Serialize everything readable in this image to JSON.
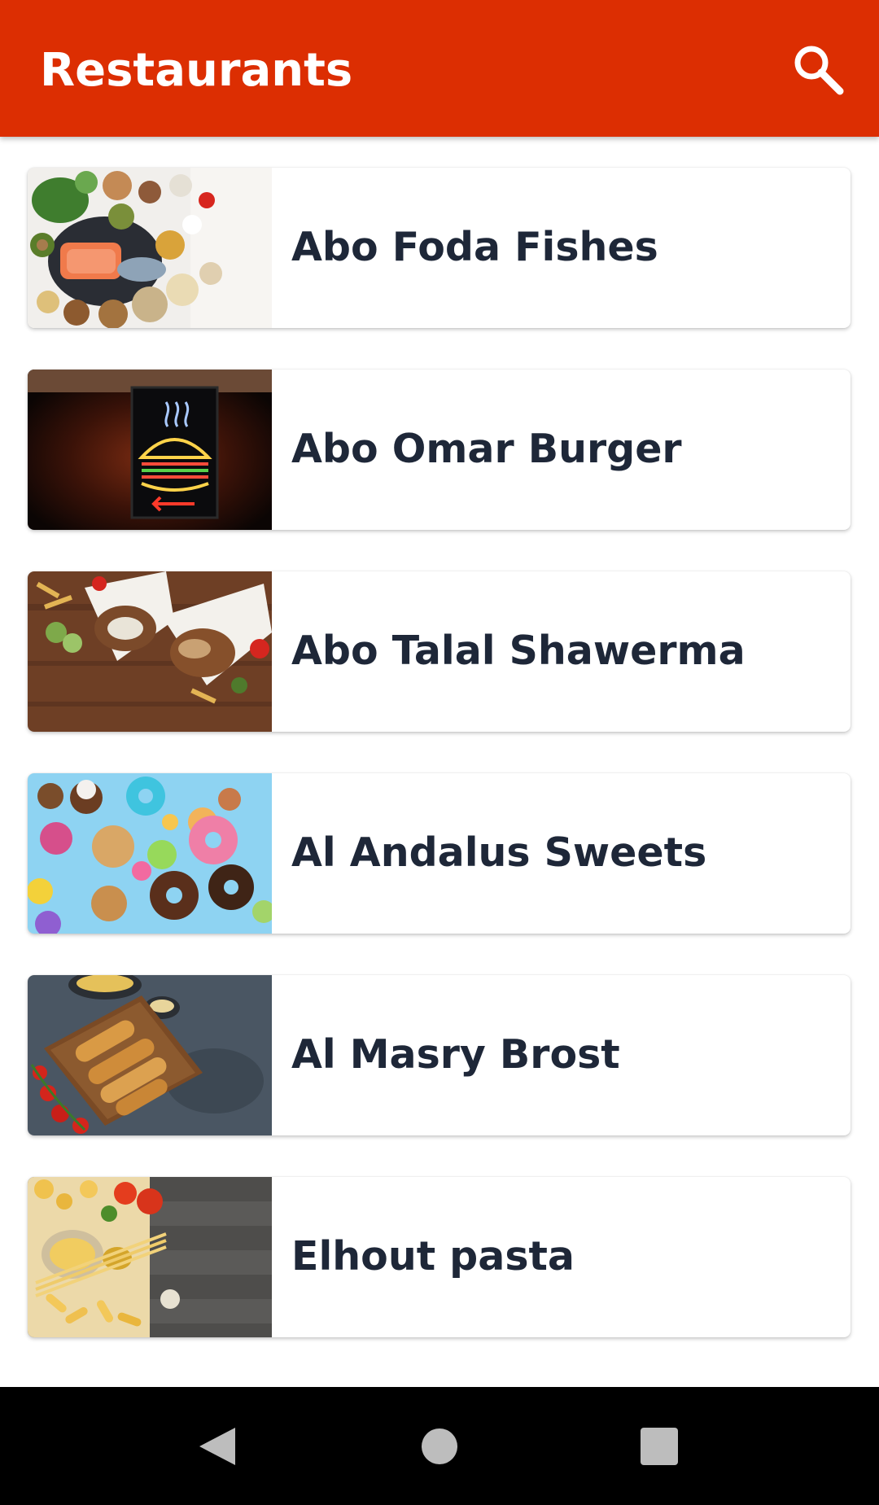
{
  "app_bar": {
    "title": "Restaurants",
    "background_color": "#dc2e02",
    "search_icon": "search-icon"
  },
  "restaurants": [
    {
      "name": "Abo Foda Fishes",
      "image": "healthy-food-spread-photo"
    },
    {
      "name": "Abo Omar Burger",
      "image": "neon-burger-sign-photo"
    },
    {
      "name": "Abo Talal Shawerma",
      "image": "shawarma-wraps-photo"
    },
    {
      "name": "Al Andalus Sweets",
      "image": "donuts-and-sweets-photo"
    },
    {
      "name": "Al Masry Brost",
      "image": "fried-chicken-strips-photo"
    },
    {
      "name": "Elhout pasta",
      "image": "pasta-ingredients-photo"
    }
  ],
  "system_nav": {
    "back_icon": "back-triangle-icon",
    "home_icon": "home-circle-icon",
    "recents_icon": "recents-square-icon"
  },
  "colors": {
    "accent": "#dc2e02",
    "card_text": "#1e2738",
    "nav_bar": "#000000"
  }
}
